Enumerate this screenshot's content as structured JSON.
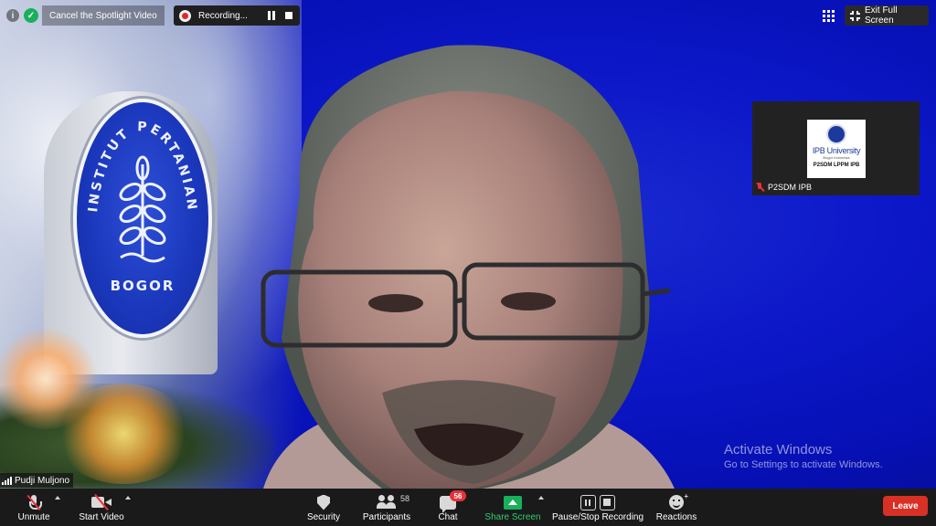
{
  "top_bar": {
    "spotlight_label": "Cancel the Spotlight Video",
    "recording_label": "Recording...",
    "exit_fullscreen_label": "Exit Full Screen"
  },
  "background": {
    "seal_text": "INSTITUT PERTANIAN",
    "seal_bottom_text": "BOGOR"
  },
  "thumbnail": {
    "logo_name": "IPB University",
    "logo_sub": "Bogor Indonesia",
    "logo_unit": "P2SDM LPPM IPB",
    "participant_name": "P2SDM IPB"
  },
  "speaker": {
    "name": "Pudji Muljono"
  },
  "watermark": {
    "title": "Activate Windows",
    "subtitle": "Go to Settings to activate Windows."
  },
  "controls": {
    "unmute": "Unmute",
    "start_video": "Start Video",
    "security": "Security",
    "participants": "Participants",
    "participant_count": "58",
    "chat": "Chat",
    "chat_badge": "56",
    "share_screen": "Share Screen",
    "recording": "Pause/Stop Recording",
    "reactions": "Reactions",
    "leave": "Leave"
  },
  "colors": {
    "background_blue": "#0c17c8",
    "share_green": "#19b05b",
    "leave_red": "#d93025",
    "muted_red": "#e5333a"
  }
}
